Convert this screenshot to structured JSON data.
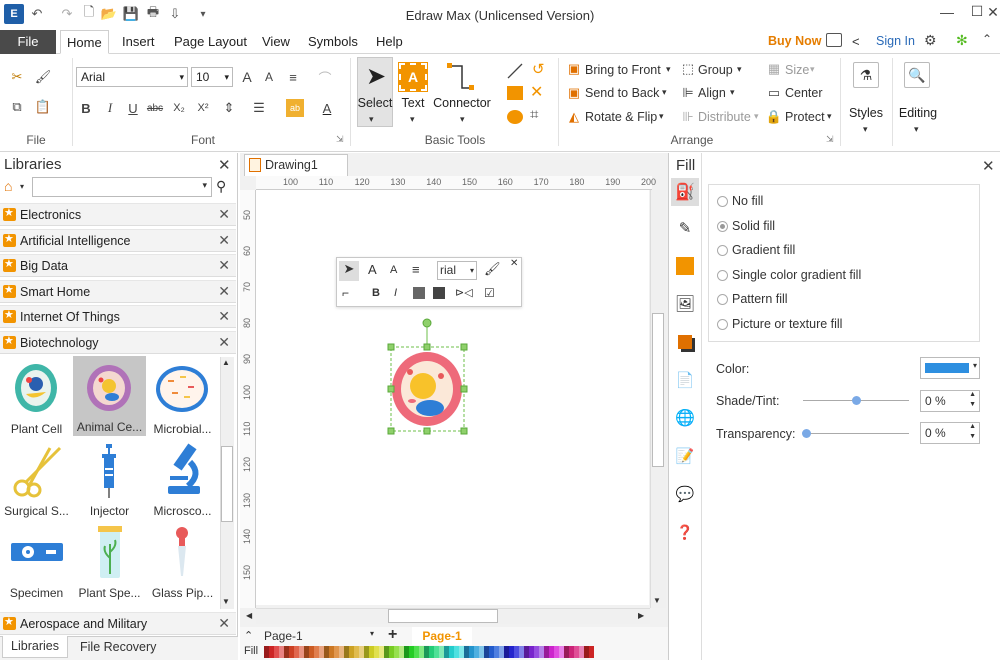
{
  "title_bar": {
    "title": "Edraw Max (Unlicensed Version)"
  },
  "menu": {
    "file": "File",
    "tabs": [
      "Home",
      "Insert",
      "Page Layout",
      "View",
      "Symbols",
      "Help"
    ],
    "buy_now": "Buy Now",
    "sign_in": "Sign In"
  },
  "ribbon": {
    "font_name": "Arial",
    "font_size": "10",
    "groups": {
      "file": "File",
      "font": "Font",
      "basic_tools": "Basic Tools",
      "arrange": "Arrange"
    },
    "tools": {
      "select": "Select",
      "text": "Text",
      "connector": "Connector"
    },
    "arrange": {
      "bring_to_front": "Bring to Front",
      "send_to_back": "Send to Back",
      "rotate_flip": "Rotate & Flip",
      "group": "Group",
      "align": "Align",
      "distribute": "Distribute",
      "size": "Size",
      "center": "Center",
      "protect": "Protect"
    },
    "styles": "Styles",
    "editing": "Editing",
    "bold": "B",
    "italic": "I",
    "underline": "U",
    "strike": "abc",
    "subscript": "X₂",
    "superscript": "X²",
    "font_color_glyph": "A"
  },
  "libraries": {
    "title": "Libraries",
    "search_value": "",
    "categories": [
      "Electronics",
      "Artificial Intelligence",
      "Big Data",
      "Smart Home",
      "Internet Of Things",
      "Biotechnology"
    ],
    "shapes": [
      "Plant Cell",
      "Animal Ce...",
      "Microbial...",
      "Surgical S...",
      "Injector",
      "Microsco...",
      "Specimen",
      "Plant Spe...",
      "Glass Pip..."
    ],
    "bottom_category": "Aerospace and Military",
    "bottom_tabs": [
      "Libraries",
      "File Recovery"
    ]
  },
  "canvas": {
    "doc_tab": "Drawing1",
    "ruler_h": [
      "100",
      "110",
      "120",
      "130",
      "140",
      "150",
      "160",
      "170",
      "180",
      "190",
      "200"
    ],
    "ruler_v": [
      "50",
      "60",
      "70",
      "80",
      "90",
      "100",
      "110",
      "120",
      "130",
      "140",
      "150"
    ],
    "float_font": "rial",
    "page_select": "Page-1",
    "page_tab": "Page-1",
    "fill_label": "Fill"
  },
  "fill_panel": {
    "title": "Fill",
    "options": [
      "No fill",
      "Solid fill",
      "Gradient fill",
      "Single color gradient fill",
      "Pattern fill",
      "Picture or texture fill"
    ],
    "selected": "Solid fill",
    "color_label": "Color:",
    "color_value": "#2e8fe0",
    "shade_label": "Shade/Tint:",
    "shade_value": "0 %",
    "transparency_label": "Transparency:",
    "transparency_value": "0 %"
  },
  "colors": {
    "accent": "#f29400",
    "fill_blue": "#2e8fe0",
    "file_bg": "#4a4a4a"
  }
}
